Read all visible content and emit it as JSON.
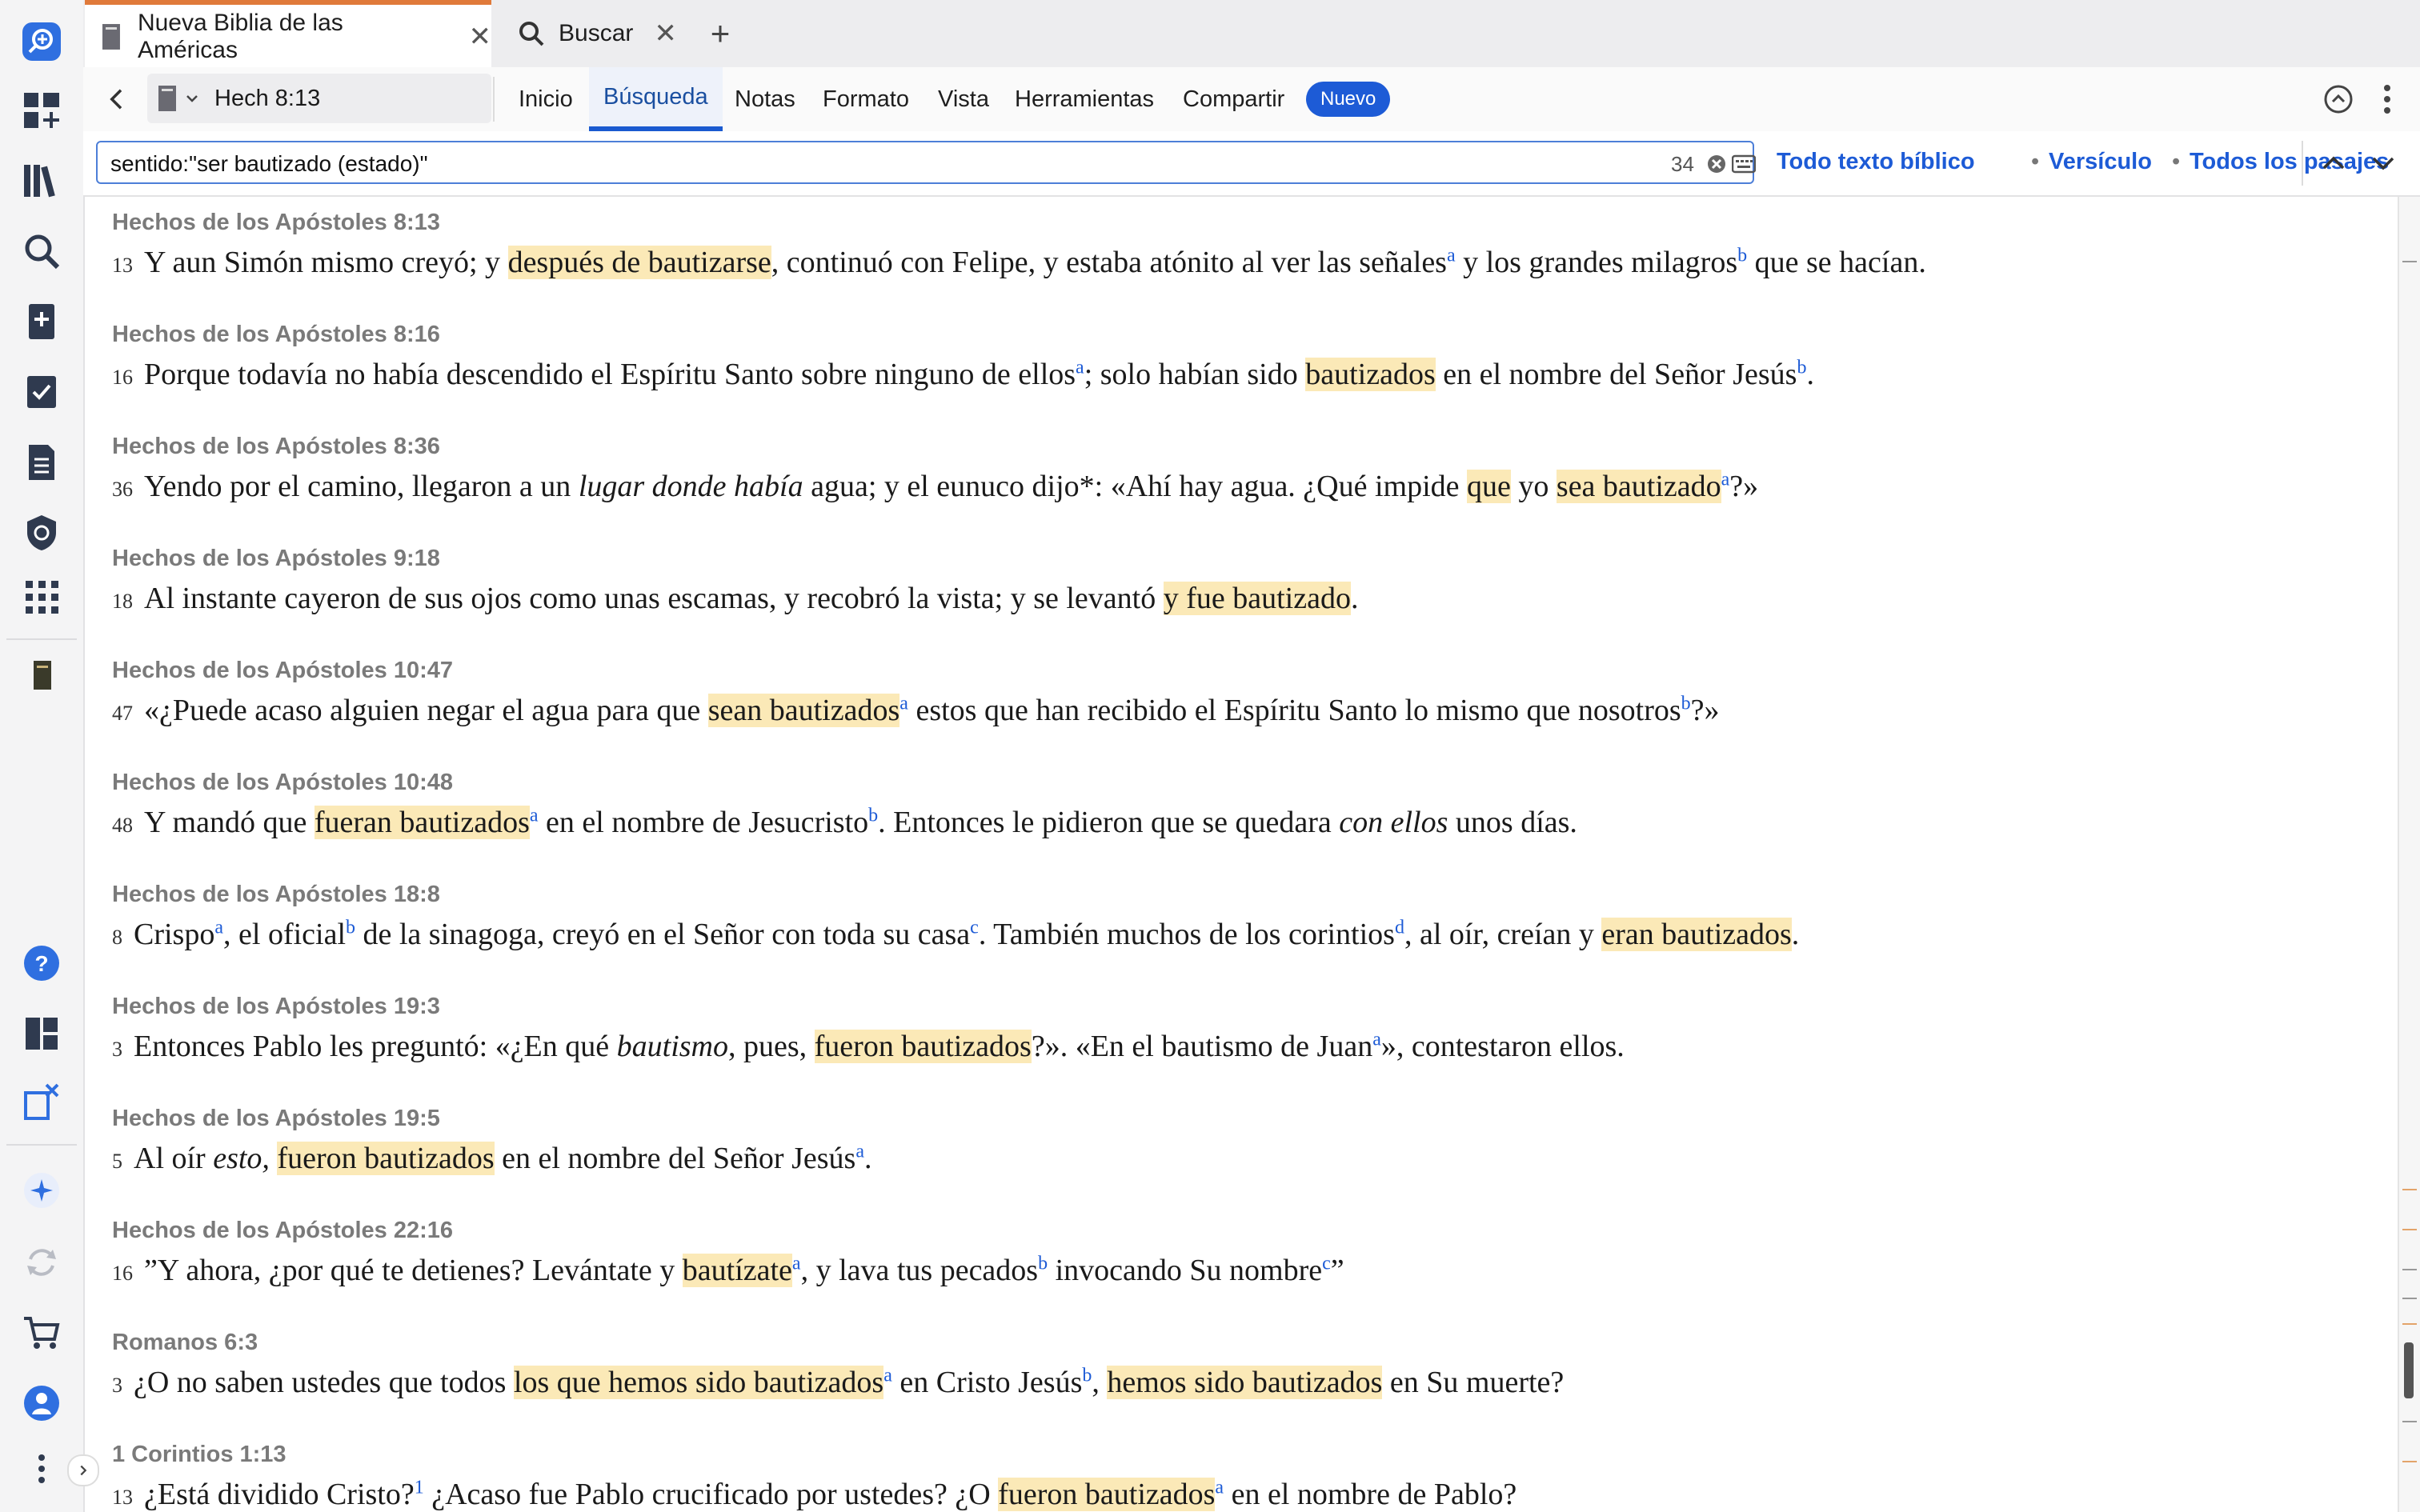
{
  "tabs": [
    {
      "label": "Nueva Biblia de las Américas",
      "active": true
    },
    {
      "label": "Buscar",
      "active": false
    }
  ],
  "toolbar": {
    "reference": "Hech 8:13",
    "menu": [
      "Inicio",
      "Búsqueda",
      "Notas",
      "Formato",
      "Vista",
      "Herramientas",
      "Compartir"
    ],
    "active_menu": "Búsqueda",
    "new_badge": "Nuevo"
  },
  "search": {
    "query": "sentido:\"ser bautizado (estado)\"",
    "count": "34",
    "scopes": [
      "Todo texto bíblico",
      "Versículo",
      "Todos los pasajes"
    ],
    "separator": "•"
  },
  "results": [
    {
      "ref": "Hechos de los Apóstoles 8:13",
      "num": "13",
      "parts": [
        [
          "Y aun Simón mismo creyó; y ",
          ""
        ],
        [
          "después de bautizarse",
          "hl"
        ],
        [
          ", continuó con Felipe, y estaba atónito al ver las señales",
          ""
        ],
        [
          "a",
          "fn"
        ],
        [
          " y los grandes milagros",
          ""
        ],
        [
          "b",
          "fn"
        ],
        [
          " que se hacían.",
          ""
        ]
      ]
    },
    {
      "ref": "Hechos de los Apóstoles 8:16",
      "num": "16",
      "parts": [
        [
          "Porque todavía no había descendido el Espíritu Santo sobre ninguno de ellos",
          ""
        ],
        [
          "a",
          "fn"
        ],
        [
          "; solo habían sido ",
          ""
        ],
        [
          "bautizados",
          "hl"
        ],
        [
          " en el nombre del Señor Jesús",
          ""
        ],
        [
          "b",
          "fn"
        ],
        [
          ".",
          ""
        ]
      ]
    },
    {
      "ref": "Hechos de los Apóstoles 8:36",
      "num": "36",
      "parts": [
        [
          "Yendo por el camino, llegaron a un ",
          ""
        ],
        [
          "lugar donde había",
          "it"
        ],
        [
          " agua; y el eunuco dijo*: «Ahí hay agua. ¿Qué impide ",
          ""
        ],
        [
          "que",
          "hl"
        ],
        [
          " yo ",
          ""
        ],
        [
          "sea bautizado",
          "hl"
        ],
        [
          "a",
          "fn"
        ],
        [
          "?»",
          ""
        ]
      ]
    },
    {
      "ref": "Hechos de los Apóstoles 9:18",
      "num": "18",
      "parts": [
        [
          "Al instante cayeron de sus ojos como unas escamas, y recobró la vista; y se levantó ",
          ""
        ],
        [
          "y fue bautizado",
          "hl"
        ],
        [
          ".",
          ""
        ]
      ]
    },
    {
      "ref": "Hechos de los Apóstoles 10:47",
      "num": "47",
      "parts": [
        [
          "«¿Puede acaso alguien negar el agua para que ",
          ""
        ],
        [
          "sean bautizados",
          "hl"
        ],
        [
          "a",
          "fn"
        ],
        [
          " estos que han recibido el Espíritu Santo lo mismo que nosotros",
          ""
        ],
        [
          "b",
          "fn"
        ],
        [
          "?»",
          ""
        ]
      ]
    },
    {
      "ref": "Hechos de los Apóstoles 10:48",
      "num": "48",
      "parts": [
        [
          "Y mandó que ",
          ""
        ],
        [
          "fueran bautizados",
          "hl"
        ],
        [
          "a",
          "fn"
        ],
        [
          " en el nombre de Jesucristo",
          ""
        ],
        [
          "b",
          "fn"
        ],
        [
          ". Entonces le pidieron que se quedara ",
          ""
        ],
        [
          "con ellos",
          "it"
        ],
        [
          " unos días.",
          ""
        ]
      ]
    },
    {
      "ref": "Hechos de los Apóstoles 18:8",
      "num": "8",
      "parts": [
        [
          "Crispo",
          ""
        ],
        [
          "a",
          "fn"
        ],
        [
          ", el oficial",
          ""
        ],
        [
          "b",
          "fn"
        ],
        [
          " de la sinagoga, creyó en el Señor con toda su casa",
          ""
        ],
        [
          "c",
          "fn"
        ],
        [
          ". También muchos de los corintios",
          ""
        ],
        [
          "d",
          "fn"
        ],
        [
          ", al oír, creían y ",
          ""
        ],
        [
          "eran bautizados",
          "hl"
        ],
        [
          ".",
          ""
        ]
      ]
    },
    {
      "ref": "Hechos de los Apóstoles 19:3",
      "num": "3",
      "parts": [
        [
          "Entonces Pablo les preguntó: «¿En qué ",
          ""
        ],
        [
          "bautismo",
          "it"
        ],
        [
          ", pues, ",
          ""
        ],
        [
          "fueron bautizados",
          "hl"
        ],
        [
          "?». «En el bautismo de Juan",
          ""
        ],
        [
          "a",
          "fn"
        ],
        [
          "», contestaron ellos.",
          ""
        ]
      ]
    },
    {
      "ref": "Hechos de los Apóstoles 19:5",
      "num": "5",
      "parts": [
        [
          "Al oír ",
          ""
        ],
        [
          "esto,",
          "it"
        ],
        [
          " ",
          ""
        ],
        [
          "fueron bautizados",
          "hl"
        ],
        [
          " en el nombre del Señor Jesús",
          ""
        ],
        [
          "a",
          "fn"
        ],
        [
          ".",
          ""
        ]
      ]
    },
    {
      "ref": "Hechos de los Apóstoles 22:16",
      "num": "16",
      "parts": [
        [
          "”Y ahora, ¿por qué te detienes? Levántate y ",
          ""
        ],
        [
          "bautízate",
          "hl"
        ],
        [
          "a",
          "fn"
        ],
        [
          ", y lava tus pecados",
          ""
        ],
        [
          "b",
          "fn"
        ],
        [
          " invocando Su nombre",
          ""
        ],
        [
          "c",
          "fn"
        ],
        [
          "”",
          ""
        ]
      ]
    },
    {
      "ref": "Romanos 6:3",
      "num": "3",
      "parts": [
        [
          "¿O no saben ustedes que todos ",
          ""
        ],
        [
          "los que hemos sido bautizados",
          "hl"
        ],
        [
          "a",
          "fn"
        ],
        [
          " en Cristo Jesús",
          ""
        ],
        [
          "b",
          "fn"
        ],
        [
          ", ",
          ""
        ],
        [
          "hemos sido bautizados",
          "hl"
        ],
        [
          " en Su muerte?",
          ""
        ]
      ]
    },
    {
      "ref": "1 Corintios 1:13",
      "num": "13",
      "parts": [
        [
          "¿Está dividido Cristo?",
          ""
        ],
        [
          "1",
          "fn"
        ],
        [
          " ¿Acaso fue Pablo crucificado por ustedes? ¿O ",
          ""
        ],
        [
          "fueron bautizados",
          "hl"
        ],
        [
          "a",
          "fn"
        ],
        [
          " en el nombre de Pablo?",
          ""
        ]
      ]
    }
  ],
  "colors": {
    "accent": "#1d5bd6",
    "highlight": "#fbe9b7",
    "tab_accent": "#e07a3a"
  }
}
